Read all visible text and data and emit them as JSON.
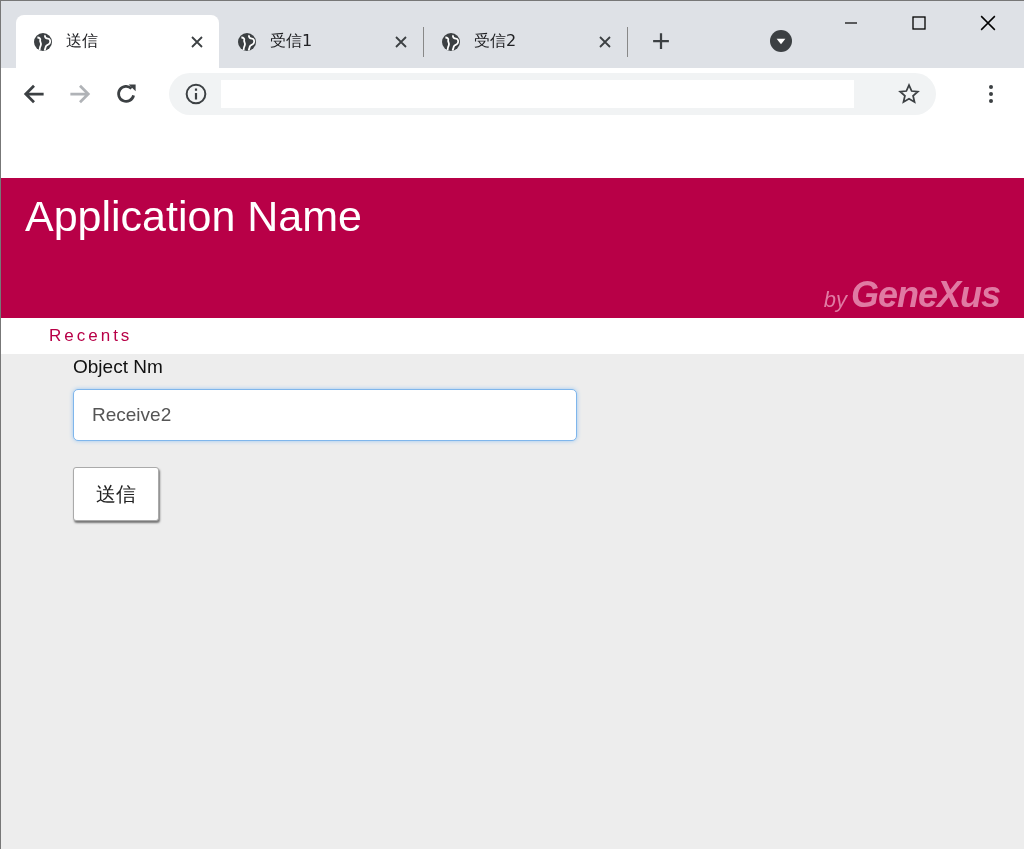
{
  "tabs": [
    {
      "title": "送信",
      "selected": true
    },
    {
      "title": "受信1",
      "selected": false
    },
    {
      "title": "受信2",
      "selected": false
    }
  ],
  "header": {
    "title": "Application Name",
    "brand_by": "by",
    "brand": "GeneXus"
  },
  "recents": {
    "label": "Recents"
  },
  "form": {
    "label": "Object Nm",
    "value": "Receive2",
    "button": "送信"
  }
}
